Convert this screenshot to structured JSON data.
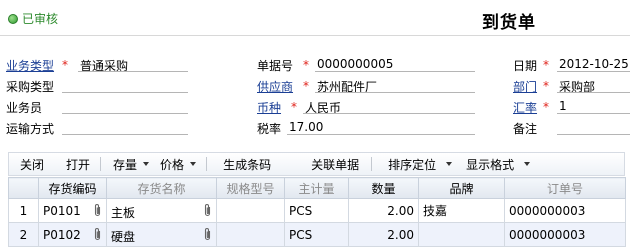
{
  "header": {
    "status": "已审核",
    "title": "到货单"
  },
  "form": {
    "business_type": {
      "label": "业务类型",
      "value": "普通采购"
    },
    "doc_no": {
      "label": "单据号",
      "value": "0000000005"
    },
    "date": {
      "label": "日期",
      "value": "2012-10-25"
    },
    "purchase_type": {
      "label": "采购类型",
      "value": ""
    },
    "supplier": {
      "label": "供应商",
      "value": "苏州配件厂"
    },
    "department": {
      "label": "部门",
      "value": "采购部"
    },
    "salesman": {
      "label": "业务员",
      "value": ""
    },
    "currency": {
      "label": "币种",
      "value": "人民币"
    },
    "exchange_rate": {
      "label": "汇率",
      "value": "1"
    },
    "shipping": {
      "label": "运输方式",
      "value": ""
    },
    "tax_rate": {
      "label": "税率",
      "value": "17.00"
    },
    "remark": {
      "label": "备注",
      "value": ""
    }
  },
  "toolbar": {
    "close": "关闭",
    "open": "打开",
    "inventory": "存量",
    "price": "价格",
    "gen_barcode": "生成条码",
    "related_docs": "关联单据",
    "sort_locate": "排序定位",
    "display_format": "显示格式"
  },
  "grid": {
    "columns": [
      "",
      "存货编码",
      "存货名称",
      "规格型号",
      "主计量",
      "数量",
      "品牌",
      "订单号"
    ],
    "rows": [
      {
        "no": "1",
        "code": "P0101",
        "name": "主板",
        "spec": "",
        "unit": "PCS",
        "qty": "2.00",
        "brand": "技嘉",
        "order": "0000000003"
      },
      {
        "no": "2",
        "code": "P0102",
        "name": "硬盘",
        "spec": "",
        "unit": "PCS",
        "qty": "2.00",
        "brand": "",
        "order": "0000000003"
      }
    ]
  }
}
